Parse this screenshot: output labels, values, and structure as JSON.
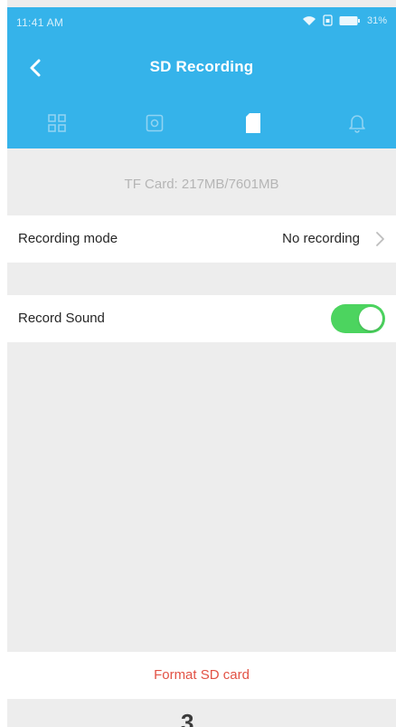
{
  "status_bar": {
    "time": "11:41 AM",
    "battery": "31%",
    "icons": [
      "wifi-icon",
      "sim-icon",
      "battery-icon"
    ]
  },
  "header": {
    "title": "SD Recording",
    "back_icon": "chevron-left-icon",
    "background_color": "#35b3ea"
  },
  "tabs": [
    {
      "icon": "grid-icon",
      "active": false
    },
    {
      "icon": "image-icon",
      "active": false
    },
    {
      "icon": "sd-card-icon",
      "active": true
    },
    {
      "icon": "bell-icon",
      "active": false
    }
  ],
  "storage": {
    "text": "TF Card: 217MB/7601MB"
  },
  "settings": {
    "recording_mode": {
      "label": "Recording mode",
      "value": "No recording",
      "icon": "chevron-right-icon"
    },
    "record_sound": {
      "label": "Record Sound",
      "enabled": true,
      "toggle_color": "#4cd45f"
    }
  },
  "actions": {
    "format_label": "Format SD card",
    "format_color": "#e25245"
  },
  "page_number": "3"
}
